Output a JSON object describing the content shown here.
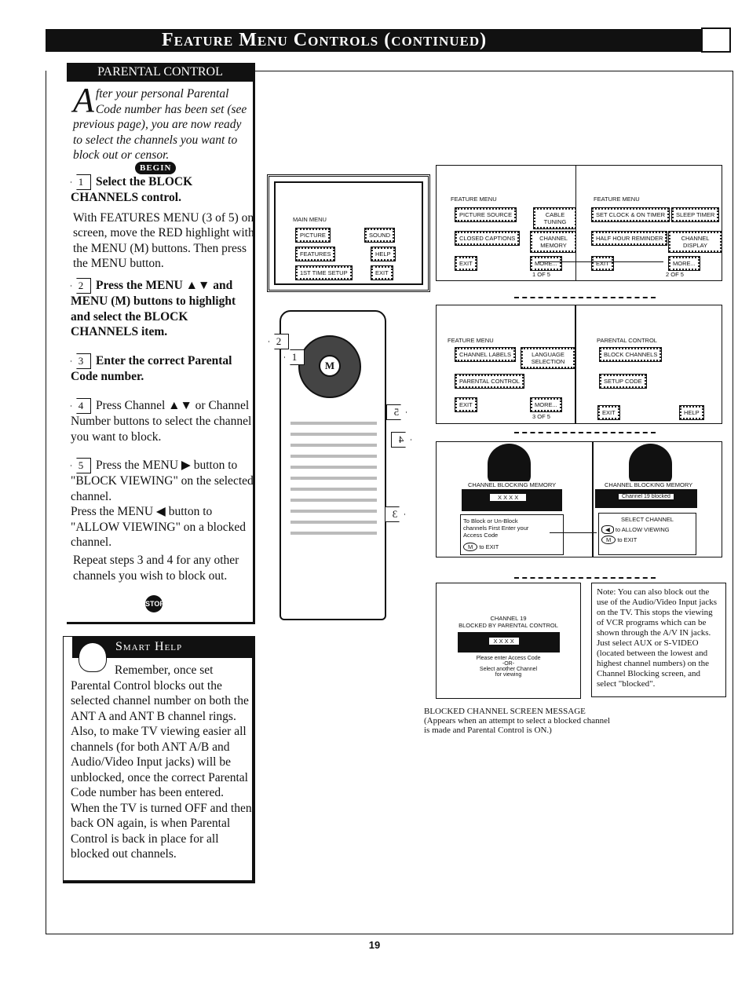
{
  "header": {
    "title": "Feature Menu Controls (continued)"
  },
  "parental_control": {
    "heading": "PARENTAL CONTROL",
    "intro_dropcap": "A",
    "intro": "fter your personal Parental Code number has been set (see previous page), you are now ready to select the channels you want to block out or censor.",
    "begin_label": "BEGIN",
    "steps": [
      {
        "num": "1",
        "text": "Select the BLOCK CHANNELS control.",
        "detail": "With FEATURES MENU (3 of 5) on screen, move the RED highlight with the MENU (M) buttons. Then press the MENU button."
      },
      {
        "num": "2",
        "text": "Press the MENU ▲▼ and MENU (M) buttons to highlight and select the BLOCK CHANNELS item."
      },
      {
        "num": "3",
        "text": "Enter the correct Parental Code number."
      },
      {
        "num": "4",
        "text": "Press Channel ▲▼ or Channel Number buttons to select the channel you want to block."
      },
      {
        "num": "5",
        "text": "Press the MENU ▶ button to \"BLOCK VIEWING\" on the selected channel.",
        "detail": "Press the MENU ◀ button to \"ALLOW VIEWING\" on a blocked channel."
      }
    ],
    "repeat": "Repeat steps 3 and 4 for any other channels you wish to block out.",
    "stop_label": "STOP"
  },
  "smart_help": {
    "heading": "Smart Help",
    "text": "Remember, once set Parental Control blocks out the selected channel number on both the ANT A and ANT B channel rings. Also, to make TV viewing easier all channels (for both ANT A/B and Audio/Video Input jacks) will be unblocked, once the correct Parental Code number has been entered. When the TV is turned OFF and then back ON again, is when Parental Control is back in place for all blocked out channels."
  },
  "screens": {
    "main_menu": {
      "title": "MAIN MENU",
      "items": [
        "PICTURE",
        "SOUND",
        "FEATURES",
        "HELP",
        "1ST TIME SETUP",
        "EXIT"
      ]
    },
    "feature1": {
      "title": "FEATURE MENU",
      "items": [
        "PICTURE SOURCE",
        "CABLE TUNING",
        "CLOSED CAPTIONS",
        "CHANNEL MEMORY",
        "EXIT",
        "MORE..."
      ],
      "page": "1 OF 5"
    },
    "feature2": {
      "title": "FEATURE MENU",
      "items": [
        "SET CLOCK & ON TIMER",
        "SLEEP TIMER",
        "HALF HOUR REMINDER",
        "CHANNEL DISPLAY",
        "EXIT",
        "MORE..."
      ],
      "page": "2 OF 5"
    },
    "feature3": {
      "title": "FEATURE MENU",
      "items": [
        "CHANNEL LABELS",
        "LANGUAGE SELECTION",
        "PARENTAL CONTROL",
        "EXIT",
        "MORE..."
      ],
      "page": "3 OF 5"
    },
    "parental": {
      "title": "PARENTAL CONTROL",
      "items": [
        "BLOCK CHANNELS",
        "SETUP CODE",
        "EXIT",
        "HELP"
      ]
    },
    "blocking1": {
      "title": "CHANNEL BLOCKING MEMORY",
      "code": "X X X X",
      "message": "To Block or Un-Block channels First Enter your Access Code",
      "exit_key": "M",
      "exit": "to EXIT"
    },
    "blocking2": {
      "title": "CHANNEL BLOCKING MEMORY",
      "status": "Channel 19 blocked",
      "select": "SELECT CHANNEL",
      "allow_key": "◀",
      "allow": "to ALLOW VIEWING",
      "exit_key": "M",
      "exit": "to EXIT"
    },
    "blocked": {
      "line1": "CHANNEL 19",
      "line2": "BLOCKED BY PARENTAL CONTROL",
      "code": "X X X X",
      "msg1": "Please enter Access Code",
      "msg2": "-OR-",
      "msg3": "Select another Channel",
      "msg4": "for viewing"
    }
  },
  "remote": {
    "callouts": [
      "1",
      "2",
      "3",
      "4",
      "5"
    ],
    "center_key": "M"
  },
  "note": "Note: You can also block out the use of the Audio/Video Input jacks on the TV. This stops the viewing of VCR programs which can be shown through the A/V IN jacks. Just select AUX or S-VIDEO (located between the lowest and highest channel numbers) on the Channel Blocking screen, and select \"blocked\".",
  "caption": {
    "title": "BLOCKED CHANNEL SCREEN MESSAGE",
    "text": "(Appears when an attempt to select a blocked channel is made and Parental Control is ON.)"
  },
  "page_number": "19"
}
